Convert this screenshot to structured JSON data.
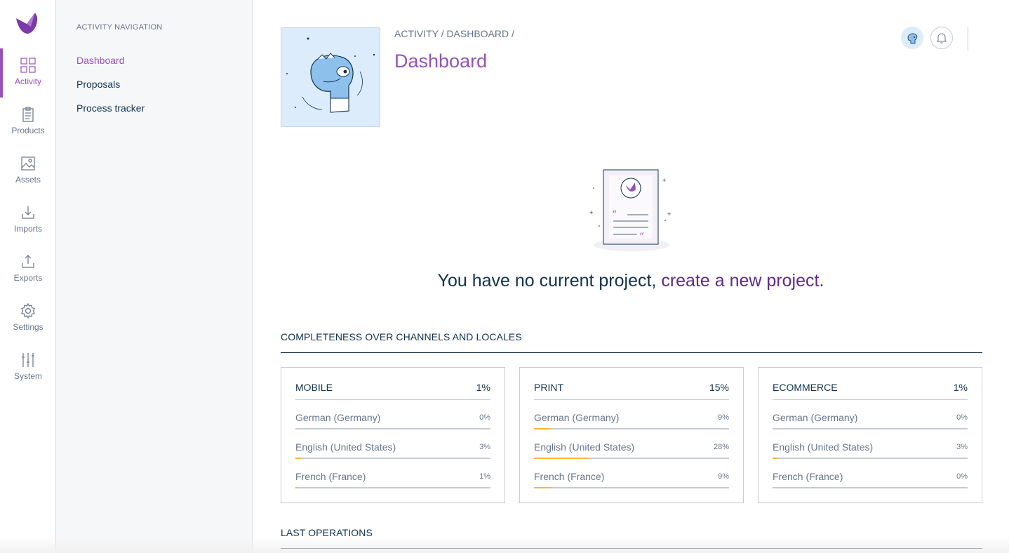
{
  "mainnav": {
    "items": [
      {
        "label": "Activity",
        "icon": "grid-icon",
        "active": true
      },
      {
        "label": "Products",
        "icon": "clipboard-icon"
      },
      {
        "label": "Assets",
        "icon": "image-icon"
      },
      {
        "label": "Imports",
        "icon": "import-icon"
      },
      {
        "label": "Exports",
        "icon": "export-icon"
      },
      {
        "label": "Settings",
        "icon": "gear-icon"
      },
      {
        "label": "System",
        "icon": "sliders-icon"
      }
    ]
  },
  "subnav": {
    "title": "ACTIVITY NAVIGATION",
    "items": [
      {
        "label": "Dashboard",
        "active": true
      },
      {
        "label": "Proposals"
      },
      {
        "label": "Process tracker"
      }
    ]
  },
  "header": {
    "breadcrumb": "ACTIVITY / DASHBOARD /",
    "title": "Dashboard"
  },
  "empty_state": {
    "text": "You have no current project, ",
    "link": "create a new project",
    "suffix": "."
  },
  "completeness": {
    "title": "COMPLETENESS OVER CHANNELS AND LOCALES",
    "channels": [
      {
        "name": "MOBILE",
        "percent": "1%",
        "locales": [
          {
            "name": "German (Germany)",
            "percent": "0%",
            "value": 0
          },
          {
            "name": "English (United States)",
            "percent": "3%",
            "value": 3
          },
          {
            "name": "French (France)",
            "percent": "1%",
            "value": 1
          }
        ]
      },
      {
        "name": "PRINT",
        "percent": "15%",
        "locales": [
          {
            "name": "German (Germany)",
            "percent": "9%",
            "value": 9
          },
          {
            "name": "English (United States)",
            "percent": "28%",
            "value": 28
          },
          {
            "name": "French (France)",
            "percent": "9%",
            "value": 9
          }
        ]
      },
      {
        "name": "ECOMMERCE",
        "percent": "1%",
        "locales": [
          {
            "name": "German (Germany)",
            "percent": "0%",
            "value": 0
          },
          {
            "name": "English (United States)",
            "percent": "3%",
            "value": 3
          },
          {
            "name": "French (France)",
            "percent": "0%",
            "value": 0
          }
        ]
      }
    ]
  },
  "last_operations": {
    "title": "LAST OPERATIONS"
  },
  "colors": {
    "accent": "#9452ba",
    "link": "#5e2a8a",
    "text": "#11324d",
    "muted": "#67768a",
    "progress": "#f9b53f"
  }
}
